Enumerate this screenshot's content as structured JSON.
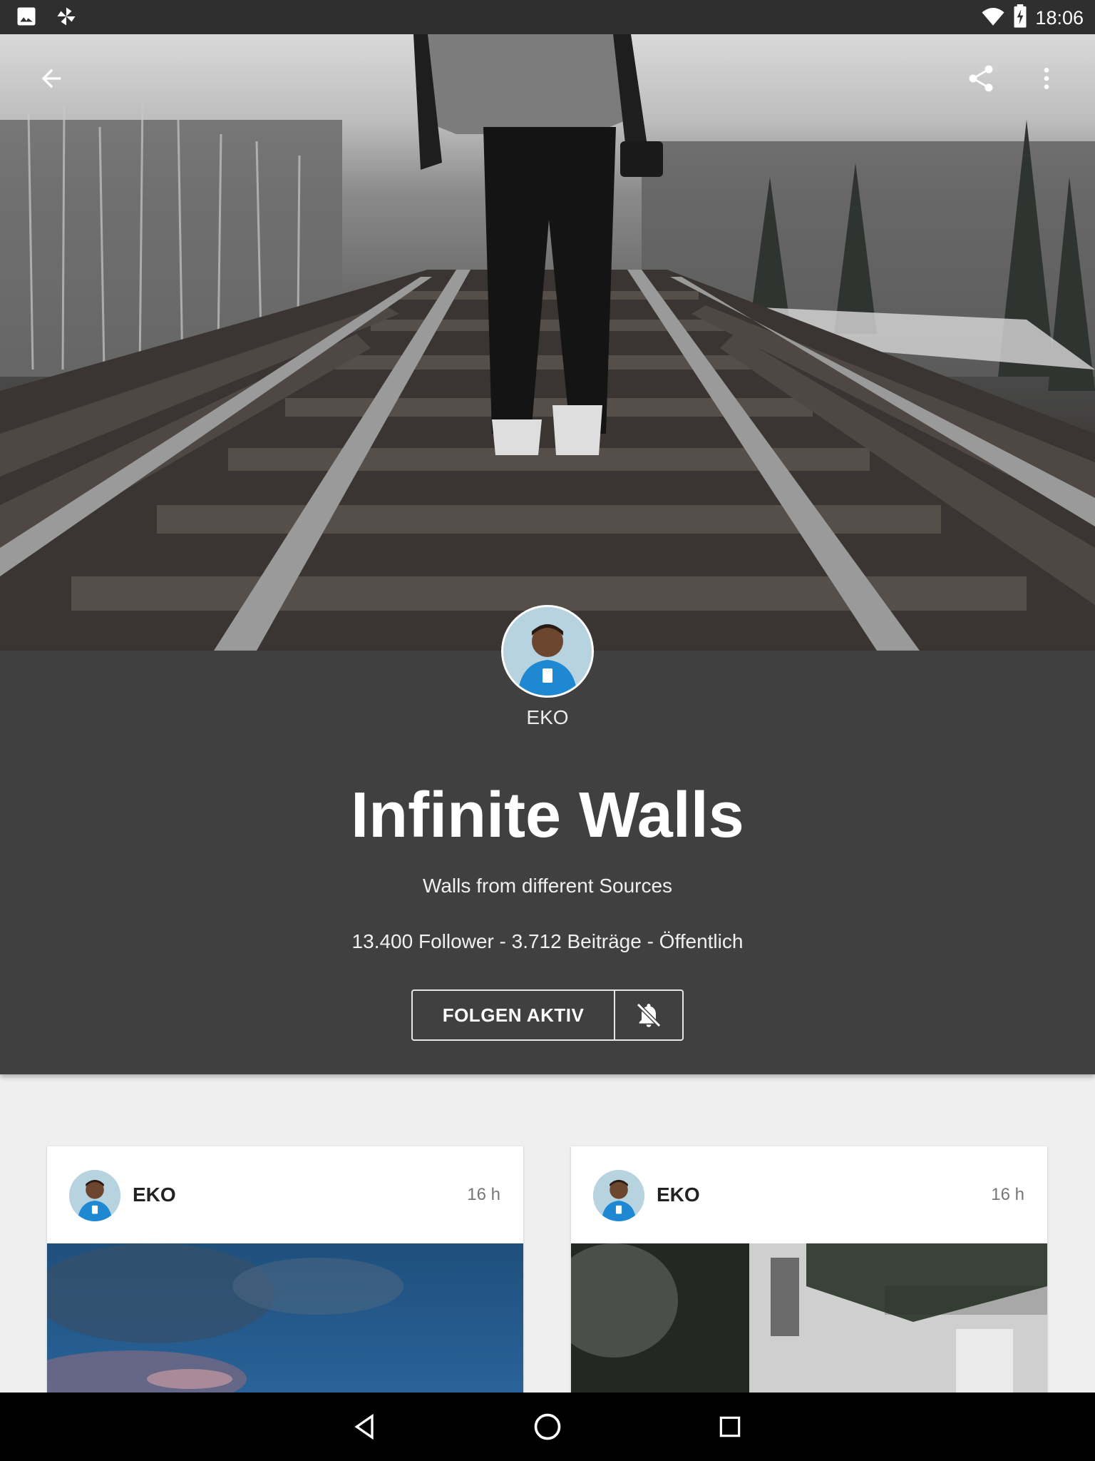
{
  "status_bar": {
    "time": "18:06",
    "icons": [
      "image-notification-icon",
      "pinwheel-notification-icon",
      "wifi-icon",
      "battery-charging-icon"
    ]
  },
  "toolbar": {
    "back_icon": "arrow-back-icon",
    "share_icon": "share-icon",
    "menu_icon": "more-vert-icon"
  },
  "collection": {
    "owner": "EKO",
    "title": "Infinite Walls",
    "subtitle": "Walls from different Sources",
    "stats": "13.400 Follower - 3.712 Beiträge - Öffentlich",
    "follow_label": "FOLGEN AKTIV",
    "bell_icon": "notifications-off-icon"
  },
  "posts": [
    {
      "author": "EKO",
      "time": "16 h"
    },
    {
      "author": "EKO",
      "time": "16 h"
    }
  ],
  "nav_bar": {
    "buttons": [
      "back-triangle-icon",
      "home-circle-icon",
      "recents-square-icon"
    ]
  },
  "colors": {
    "status_bar": "#2f2f2f",
    "info_panel": "#404040",
    "page_bg": "#efefef",
    "nav_bar": "#000000"
  }
}
